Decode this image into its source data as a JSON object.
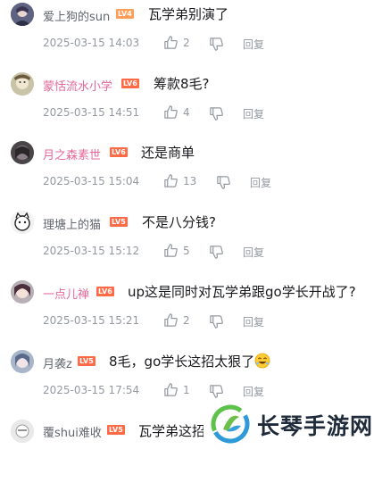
{
  "comments": [
    {
      "user": "爱上狗的sun",
      "level": "LV4",
      "level_color": "#ff9e58",
      "text": "瓦学弟别演了",
      "date": "2025-03-15 14:03",
      "likes": "2",
      "reply": "回复"
    },
    {
      "user": "蒙恬流水小学",
      "level": "LV6",
      "level_color": "#ff6b46",
      "text": "筹款8毛?",
      "date": "2025-03-15 14:51",
      "likes": "4",
      "reply": "回复"
    },
    {
      "user": "月之森素世",
      "level": "LV6",
      "level_color": "#ff6b46",
      "text": "还是商单",
      "date": "2025-03-15 15:04",
      "likes": "13",
      "reply": "回复"
    },
    {
      "user": "理塘上的猫",
      "level": "LV5",
      "level_color": "#ff6b46",
      "text": "不是八分钱?",
      "date": "2025-03-15 15:12",
      "likes": "5",
      "reply": "回复"
    },
    {
      "user": "一点儿禅",
      "level": "LV6",
      "level_color": "#ff6b46",
      "text": "up这是同时对瓦学弟跟go学长开战了?",
      "date": "2025-03-15 15:21",
      "likes": "2",
      "reply": "回复"
    },
    {
      "user": "月袭z",
      "level": "LV5",
      "level_color": "#ff6b46",
      "text": "8毛，go学长这招太狠了",
      "date": "2025-03-15 17:54",
      "likes": "1",
      "reply": "回复"
    },
    {
      "user": "覆shui难收",
      "level": "LV5",
      "level_color": "#ff6b46",
      "text": "瓦学弟这招",
      "date": "",
      "likes": "",
      "reply": ""
    }
  ],
  "watermark": {
    "text": "长琴手游网"
  },
  "colors": {
    "vip_name": "#e5689a",
    "name": "#61666d",
    "meta": "#9499a0"
  },
  "icons": {
    "like": "thumbs-up-icon",
    "dislike": "thumbs-down-icon",
    "emoji": "laughing-emoji-icon"
  }
}
